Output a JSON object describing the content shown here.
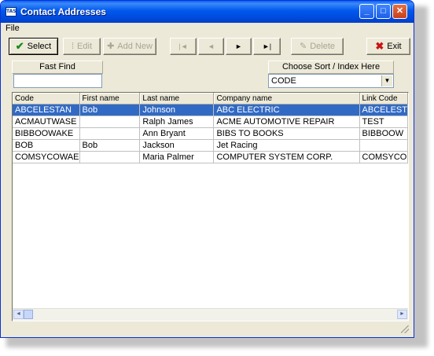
{
  "window": {
    "title": "Contact Addresses",
    "app_icon_text": "TAS",
    "controls": {
      "minimize": "_",
      "maximize": "□",
      "close": "✕"
    }
  },
  "menu": {
    "file": "File"
  },
  "toolbar": {
    "select": {
      "label": "Select",
      "icon": "check-icon"
    },
    "edit": {
      "label": "Edit",
      "icon": "pencil-icon"
    },
    "add_new": {
      "label": "Add New",
      "icon": "plus-icon"
    },
    "first": "|◄",
    "prev": "◄",
    "next": "►",
    "last": "►|",
    "delete": {
      "label": "Delete",
      "icon": "eraser-icon"
    },
    "exit": {
      "label": "Exit",
      "icon": "x-icon"
    }
  },
  "fast_find": {
    "label": "Fast Find",
    "value": ""
  },
  "sort": {
    "label": "Choose Sort / Index Here",
    "value": "CODE"
  },
  "grid": {
    "columns": [
      "Code",
      "First name",
      "Last name",
      "Company name",
      "Link Code"
    ],
    "rows": [
      {
        "code": "ABCELESTAN",
        "first": "Bob",
        "last": "Johnson",
        "company": "ABC ELECTRIC",
        "link": "ABCELEST"
      },
      {
        "code": "ACMAUTWASE",
        "first": "",
        "last": "Ralph James",
        "company": "ACME AUTOMOTIVE REPAIR",
        "link": "TEST"
      },
      {
        "code": "BIBBOOWAKE",
        "first": "",
        "last": "Ann Bryant",
        "company": "BIBS TO BOOKS",
        "link": "BIBBOOW"
      },
      {
        "code": "BOB",
        "first": "Bob",
        "last": "Jackson",
        "company": "Jet Racing",
        "link": ""
      },
      {
        "code": "COMSYCOWAE",
        "first": "",
        "last": "Maria Palmer",
        "company": "COMPUTER SYSTEM CORP.",
        "link": "COMSYCO"
      }
    ],
    "selected_row": 0
  },
  "colors": {
    "titlebar": "#0058ee",
    "selection": "#316ac5",
    "face": "#ece9d8"
  }
}
